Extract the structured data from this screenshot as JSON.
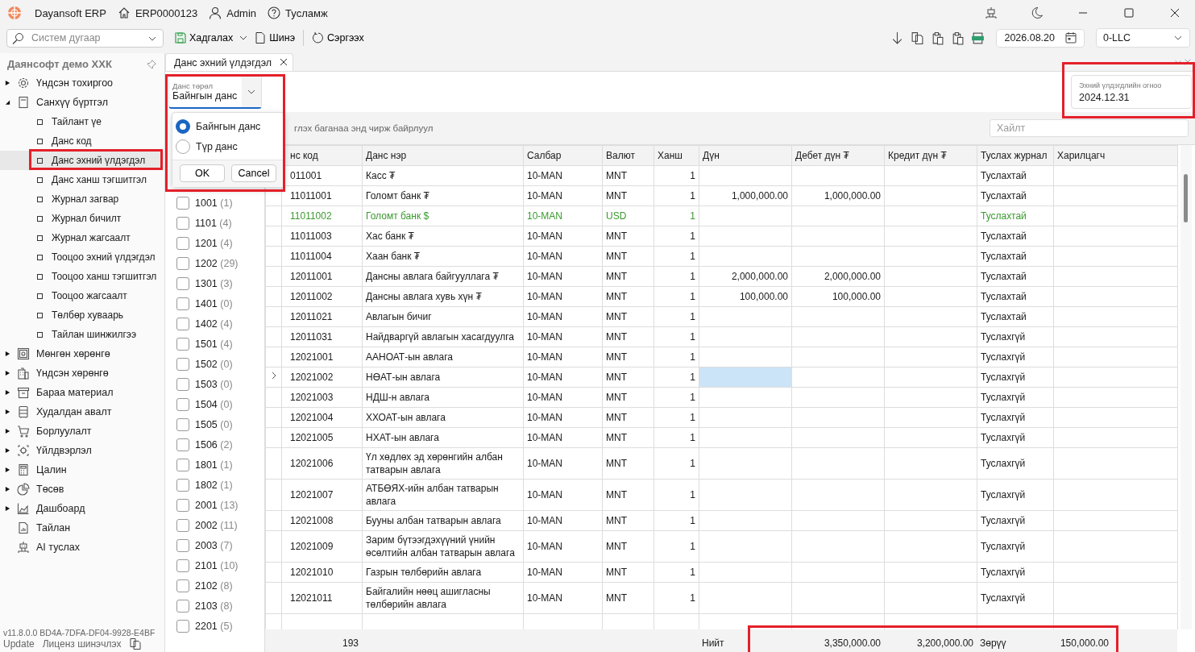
{
  "titlebar": {
    "app": "Dayansoft ERP",
    "doc": "ERP0000123",
    "user": "Admin",
    "help": "Тусламж"
  },
  "toolbar": {
    "search": {
      "placeholder": "Систем дугаар"
    },
    "save": "Хадгалах",
    "new": "Шинэ",
    "refresh": "Сэргээх",
    "date": "2026.08.20",
    "company": "0-LLC"
  },
  "sidebar": {
    "title": "Даянсофт демо ХХК",
    "items": [
      {
        "label": "Үндсэн тохиргоо",
        "expanded": false
      },
      {
        "label": "Санхүү бүртгэл",
        "expanded": true,
        "children": [
          {
            "label": "Тайлант үе",
            "selected": false
          },
          {
            "label": "Данс код",
            "selected": false
          },
          {
            "label": "Данс эхний үлдэгдэл",
            "selected": true
          },
          {
            "label": "Данс ханш тэгшитгэл",
            "selected": false
          },
          {
            "label": "Журнал загвар",
            "selected": false
          },
          {
            "label": "Журнал бичилт",
            "selected": false
          },
          {
            "label": "Журнал жагсаалт",
            "selected": false
          },
          {
            "label": "Тооцоо эхний үлдэгдэл",
            "selected": false
          },
          {
            "label": "Тооцоо ханш тэгшитгэл",
            "selected": false
          },
          {
            "label": "Тооцоо жагсаалт",
            "selected": false
          },
          {
            "label": "Төлбөр хуваарь",
            "selected": false
          },
          {
            "label": "Тайлан шинжилгээ",
            "selected": false
          }
        ]
      },
      {
        "label": "Мөнгөн хөрөнгө",
        "expanded": false
      },
      {
        "label": "Үндсэн хөрөнгө",
        "expanded": false
      },
      {
        "label": "Бараа материал",
        "expanded": false
      },
      {
        "label": "Худалдан авалт",
        "expanded": false
      },
      {
        "label": "Борлуулалт",
        "expanded": false
      },
      {
        "label": "Үйлдвэрлэл",
        "expanded": false
      },
      {
        "label": "Цалин",
        "expanded": false
      },
      {
        "label": "Төсөв",
        "expanded": false
      },
      {
        "label": "Дашбоард",
        "expanded": false
      },
      {
        "label": "Тайлан"
      },
      {
        "label": "AI туслах"
      }
    ],
    "version": "v11.8.0.0",
    "license": "BD4A-7DFA-DF04-9928-E4BF",
    "update": "Update",
    "renew": "Лиценз шинэчлэх"
  },
  "tab": {
    "label": "Данс эхний үлдэгдэл"
  },
  "account_type": {
    "label": "Данс төрөл",
    "value": "Байнгын данс",
    "options": [
      {
        "label": "Байнгын данс",
        "selected": true
      },
      {
        "label": "Түр данс",
        "selected": false
      }
    ],
    "buttons": [
      "OK",
      "Cancel"
    ]
  },
  "opening_date": {
    "label": "Эхний үлдэгдлийн огноо",
    "value": "2024.12.31"
  },
  "filter_list": [
    {
      "code": "1001",
      "count": "(1)",
      "checked": false
    },
    {
      "code": "1101",
      "count": "(4)",
      "checked": false
    },
    {
      "code": "1201",
      "count": "(4)",
      "checked": false
    },
    {
      "code": "1202",
      "count": "(29)",
      "checked": false
    },
    {
      "code": "1301",
      "count": "(3)",
      "checked": false
    },
    {
      "code": "1401",
      "count": "(0)",
      "checked": false
    },
    {
      "code": "1402",
      "count": "(4)",
      "checked": false
    },
    {
      "code": "1501",
      "count": "(4)",
      "checked": false
    },
    {
      "code": "1502",
      "count": "(0)",
      "checked": false
    },
    {
      "code": "1503",
      "count": "(0)",
      "checked": false
    },
    {
      "code": "1504",
      "count": "(0)",
      "checked": false
    },
    {
      "code": "1505",
      "count": "(0)",
      "checked": false
    },
    {
      "code": "1506",
      "count": "(2)",
      "checked": false
    },
    {
      "code": "1801",
      "count": "(1)",
      "checked": false
    },
    {
      "code": "1802",
      "count": "(1)",
      "checked": false
    },
    {
      "code": "2001",
      "count": "(13)",
      "checked": false
    },
    {
      "code": "2002",
      "count": "(11)",
      "checked": false
    },
    {
      "code": "2003",
      "count": "(7)",
      "checked": false
    },
    {
      "code": "2101",
      "count": "(10)",
      "checked": false
    },
    {
      "code": "2102",
      "count": "(8)",
      "checked": false
    },
    {
      "code": "2103",
      "count": "(8)",
      "checked": false
    },
    {
      "code": "2201",
      "count": "(5)",
      "checked": false
    }
  ],
  "group_panel": {
    "hint": "глэх баганаа энд чирж байрлуул"
  },
  "grid_search": {
    "placeholder": "Хайлт"
  },
  "table": {
    "columns": [
      "нс код",
      "Данс нэр",
      "Салбар",
      "Валют",
      "Ханш",
      "Дүн",
      "Дебет дүн ₮",
      "Кредит дүн ₮",
      "Туслах журнал",
      "Харилцагч"
    ],
    "rows": [
      {
        "cells": [
          "011001",
          "Касс ₮",
          "10-MAN",
          "MNT",
          "1",
          null,
          null,
          null,
          "Туслахтай",
          null
        ],
        "color": "#1a1a1a",
        "current": false
      },
      {
        "cells": [
          "11011001",
          "Голомт банк ₮",
          "10-MAN",
          "MNT",
          "1",
          "1,000,000.00",
          "1,000,000.00",
          null,
          "Туслахтай",
          null
        ],
        "color": "#1a1a1a",
        "current": false
      },
      {
        "cells": [
          "11011002",
          "Голомт банк $",
          "10-MAN",
          "USD",
          "1",
          null,
          null,
          null,
          "Туслахтай",
          null
        ],
        "color": "#3a9a2e",
        "current": false
      },
      {
        "cells": [
          "11011003",
          "Хас банк ₮",
          "10-MAN",
          "MNT",
          "1",
          null,
          null,
          null,
          "Туслахтай",
          null
        ],
        "color": "#1a1a1a",
        "current": false
      },
      {
        "cells": [
          "11011004",
          "Хаан банк ₮",
          "10-MAN",
          "MNT",
          "1",
          null,
          null,
          null,
          "Туслахтай",
          null
        ],
        "color": "#1a1a1a",
        "current": false
      },
      {
        "cells": [
          "12011001",
          "Дансны авлага байгууллага ₮",
          "10-MAN",
          "MNT",
          "1",
          "2,000,000.00",
          "2,000,000.00",
          null,
          "Туслахтай",
          null
        ],
        "color": "#1a1a1a",
        "current": false
      },
      {
        "cells": [
          "12011002",
          "Дансны авлага хувь хүн ₮",
          "10-MAN",
          "MNT",
          "1",
          "100,000.00",
          "100,000.00",
          null,
          "Туслахтай",
          null
        ],
        "color": "#1a1a1a",
        "current": false
      },
      {
        "cells": [
          "12011021",
          "Авлагын бичиг",
          "10-MAN",
          "MNT",
          "1",
          null,
          null,
          null,
          "Туслахтай",
          null
        ],
        "color": "#1a1a1a",
        "current": false
      },
      {
        "cells": [
          "12011031",
          "Найдваргүй авлагын хасагдуулга",
          "10-MAN",
          "MNT",
          "1",
          null,
          null,
          null,
          "Туслахгүй",
          null
        ],
        "color": "#1a1a1a",
        "current": false
      },
      {
        "cells": [
          "12021001",
          "ААНОАТ-ын авлага",
          "10-MAN",
          "MNT",
          "1",
          null,
          null,
          null,
          "Туслахгүй",
          null
        ],
        "color": "#1a1a1a",
        "current": false
      },
      {
        "cells": [
          "12021002",
          "НӨАТ-ын авлага",
          "10-MAN",
          "MNT",
          "1",
          null,
          null,
          null,
          "Туслахгүй",
          null
        ],
        "color": "#1a1a1a",
        "current": true
      },
      {
        "cells": [
          "12021003",
          "НДШ-н авлага",
          "10-MAN",
          "MNT",
          "1",
          null,
          null,
          null,
          "Туслахгүй",
          null
        ],
        "color": "#1a1a1a",
        "current": false
      },
      {
        "cells": [
          "12021004",
          "ХХОАТ-ын авлага",
          "10-MAN",
          "MNT",
          "1",
          null,
          null,
          null,
          "Туслахгүй",
          null
        ],
        "color": "#1a1a1a",
        "current": false
      },
      {
        "cells": [
          "12021005",
          "НХАТ-ын авлага",
          "10-MAN",
          "MNT",
          "1",
          null,
          null,
          null,
          "Туслахгүй",
          null
        ],
        "color": "#1a1a1a",
        "current": false
      },
      {
        "cells": [
          "12021006",
          "Үл хөдлөх эд хөрөнгийн албан татварын авлага",
          "10-MAN",
          "MNT",
          "1",
          null,
          null,
          null,
          "Туслахгүй",
          null
        ],
        "color": "#1a1a1a",
        "current": false
      },
      {
        "cells": [
          "12021007",
          "АТБӨЯХ-ийн албан татварын авлага",
          "10-MAN",
          "MNT",
          "1",
          null,
          null,
          null,
          "Туслахгүй",
          null
        ],
        "color": "#1a1a1a",
        "current": false
      },
      {
        "cells": [
          "12021008",
          "Бууны албан татварын авлага",
          "10-MAN",
          "MNT",
          "1",
          null,
          null,
          null,
          "Туслахгүй",
          null
        ],
        "color": "#1a1a1a",
        "current": false
      },
      {
        "cells": [
          "12021009",
          "Зарим бүтээгдэхүүний үнийн өсөлтийн албан татварын авлага",
          "10-MAN",
          "MNT",
          "1",
          null,
          null,
          null,
          "Туслахгүй",
          null
        ],
        "color": "#1a1a1a",
        "current": false
      },
      {
        "cells": [
          "12021010",
          "Газрын төлбөрийн авлага",
          "10-MAN",
          "MNT",
          "1",
          null,
          null,
          null,
          "Туслахгүй",
          null
        ],
        "color": "#1a1a1a",
        "current": false
      },
      {
        "cells": [
          "12021011",
          "Байгалийн нөөц ашигласны төлбөрийн авлага",
          "10-MAN",
          "MNT",
          "1",
          null,
          null,
          null,
          "Туслахгүй",
          null
        ],
        "color": "#1a1a1a",
        "current": false
      }
    ]
  },
  "totals": {
    "count": "193",
    "total_label": "Нийт",
    "debit": "3,350,000.00",
    "credit": "3,200,000.00",
    "difference_label": "Зөрүү",
    "difference": "150,000.00"
  }
}
